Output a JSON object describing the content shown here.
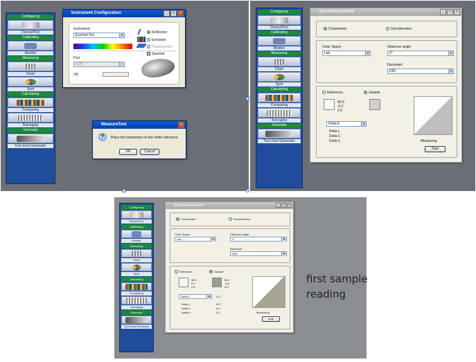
{
  "sidebar": {
    "items": [
      {
        "header": "Configuring",
        "label": "Device/Port",
        "icon": "device-thumb-icon"
      },
      {
        "header": "Calibrating",
        "label": "Monitor",
        "icon": "monitor-thumb-icon"
      },
      {
        "header": "Measuring",
        "label": "Chart",
        "icon": "chart-thumb-icon"
      },
      {
        "header": "",
        "label": "Spot",
        "icon": "spot-thumb-icon"
      },
      {
        "header": "Calculating",
        "label": "Comparing",
        "icon": "compare-thumb-icon"
      },
      {
        "header": "",
        "label": "Averaging",
        "icon": "averaging-thumb-icon"
      },
      {
        "header": "Generate",
        "label": "Test chart Generator",
        "icon": "generator-thumb-icon"
      }
    ]
  },
  "instrument_config": {
    "title": "Instrument Configuration",
    "instrument_label": "Instrument",
    "instrument_value": "EyeOne Pro",
    "opt_reflection": "Reflection",
    "opt_emission": "Emission",
    "opt_transmission": "Transmission",
    "opt_spectral": "Spectral",
    "port_label": "Port",
    "port_value": "USB",
    "ok_label": "OK"
  },
  "measure_dialog": {
    "title": "MeasureTool",
    "message": "Place the instrument on the white reference.",
    "ok": "OK",
    "cancel": "Cancel"
  },
  "spot_top": {
    "title": "Spot Measurement",
    "colorimetric": "Colorimetric",
    "densitometric": "Densitometric",
    "color_space_label": "Color Space",
    "color_space_value": "Lab",
    "observer_label": "Observer angle",
    "observer_value": "2°",
    "illuminant_label": "Illuminant",
    "illuminant_value": "D65",
    "reference": "Reference",
    "sample": "Sample",
    "ref_values": [
      "95.9",
      "-0.2",
      "2.6"
    ],
    "delta_value": "Delta E",
    "delta_labels": [
      "Delta L",
      "Delta C",
      "Delta h"
    ],
    "measuring": "Measuring",
    "start": "Start"
  },
  "spot_bottom": {
    "title": "Spot Measurement",
    "colorimetric": "Colorimetric",
    "densitometric": "Densitometric",
    "color_space_label": "Color Space",
    "color_space_value": "Lab",
    "observer_label": "Observer angle",
    "observer_value": "2°",
    "illuminant_label": "Illuminant",
    "illuminant_value": "D50",
    "reference": "Reference",
    "sample": "Sample",
    "ref_values": [
      "95.9",
      "0.1",
      "2.5"
    ],
    "sample_values": [
      "65.2",
      "-0.5",
      "9.5"
    ],
    "delta_value": "Delta E",
    "delta_e": "21.7",
    "delta_labels": [
      "Delta L",
      "Delta C",
      "Delta h"
    ],
    "delta_numbers": [
      "30.7",
      "6.9",
      "0.2"
    ],
    "measuring": "Measuring",
    "start": "Start"
  },
  "caption": {
    "line1": "first sample",
    "line2": "reading"
  },
  "colors": {
    "backdrop": "#6b6f75",
    "xp_title": "#0a5bd8",
    "sidebar": "#1f4d9c",
    "header_green": "#1a8a3a"
  }
}
